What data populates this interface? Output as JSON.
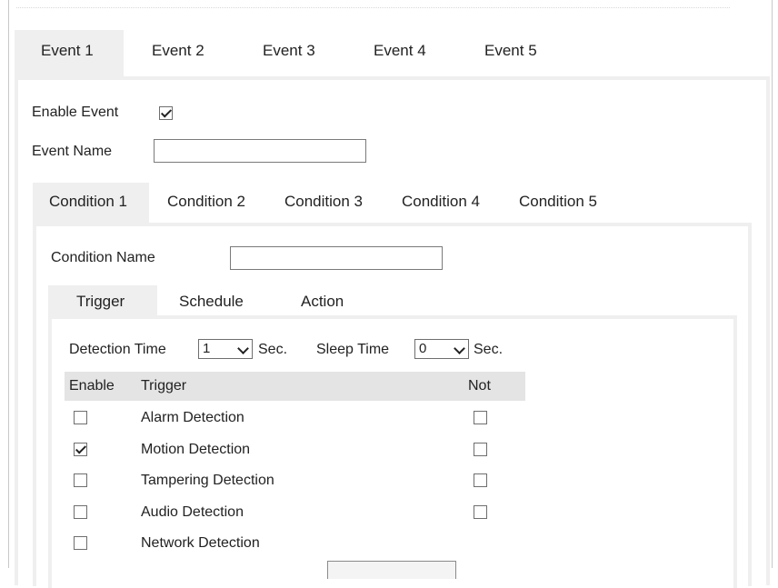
{
  "event_tabs": [
    {
      "label": "Event 1"
    },
    {
      "label": "Event 2"
    },
    {
      "label": "Event 3"
    },
    {
      "label": "Event 4"
    },
    {
      "label": "Event 5"
    }
  ],
  "event_form": {
    "enable_label": "Enable Event",
    "enable_checked": true,
    "name_label": "Event Name",
    "name_value": ""
  },
  "condition_tabs": [
    {
      "label": "Condition 1"
    },
    {
      "label": "Condition 2"
    },
    {
      "label": "Condition 3"
    },
    {
      "label": "Condition 4"
    },
    {
      "label": "Condition 5"
    }
  ],
  "condition_form": {
    "name_label": "Condition Name",
    "name_value": ""
  },
  "trigger_tabs": [
    {
      "label": "Trigger"
    },
    {
      "label": "Schedule"
    },
    {
      "label": "Action"
    }
  ],
  "trigger_settings": {
    "detection_time_label": "Detection Time",
    "detection_time_value": "1",
    "detection_unit": "Sec.",
    "sleep_time_label": "Sleep Time",
    "sleep_time_value": "0",
    "sleep_unit": "Sec."
  },
  "trigger_table": {
    "headers": {
      "enable": "Enable",
      "trigger": "Trigger",
      "not": "Not"
    },
    "rows": [
      {
        "name": "Alarm Detection",
        "enabled": false,
        "not": false
      },
      {
        "name": "Motion Detection",
        "enabled": true,
        "not": false
      },
      {
        "name": "Tampering Detection",
        "enabled": false,
        "not": false
      },
      {
        "name": "Audio Detection",
        "enabled": false,
        "not": false
      },
      {
        "name": "Network Detection",
        "enabled": false
      }
    ]
  }
}
